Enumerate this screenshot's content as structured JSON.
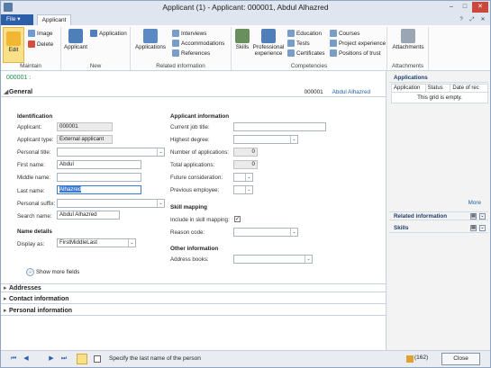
{
  "window": {
    "title": "Applicant (1) - Applicant: 000001, Abdul Alhazred",
    "min": "–",
    "max": "□",
    "close": "✕"
  },
  "tabs": {
    "file": "File",
    "file_arrow": "▾",
    "applicant": "Applicant"
  },
  "quick_icons": [
    "?",
    "⤢",
    "✕"
  ],
  "ribbon": {
    "maintain": {
      "label": "Maintain",
      "edit": "Edit",
      "image": "Image",
      "delete": "Delete"
    },
    "new": {
      "label": "New",
      "applicant": "Applicant",
      "application": "Application"
    },
    "related": {
      "label": "Related information",
      "applications": "Applications",
      "interviews": "Interviews",
      "accommodations": "Accommodations",
      "references": "References"
    },
    "competencies": {
      "label": "Competencies",
      "skills": "Skills",
      "professional": "Professional",
      "experience": "experience",
      "education": "Education",
      "tests": "Tests",
      "certificates": "Certificates",
      "courses": "Courses",
      "project_experience": "Project experience",
      "positions": "Positions of trust"
    },
    "attachments": {
      "label": "Attachments",
      "attachments": "Attachments"
    }
  },
  "crumb": "000001 :",
  "general": {
    "caret": "◢",
    "title": "General",
    "id": "000001",
    "name": "Abdul Alhazred"
  },
  "identification": {
    "heading": "Identification",
    "applicant_label": "Applicant:",
    "applicant_value": "000001",
    "type_label": "Applicant type:",
    "type_value": "External applicant",
    "personal_title_label": "Personal title:",
    "personal_title_value": "",
    "first_label": "First name:",
    "first_value": "Abdul",
    "middle_label": "Middle name:",
    "middle_value": "",
    "last_label": "Last name:",
    "last_value": "Alhazred",
    "suffix_label": "Personal suffix:",
    "suffix_value": "",
    "search_label": "Search name:",
    "search_value": "Abdul Alhazred"
  },
  "name_details": {
    "heading": "Name details",
    "display_label": "Display as:",
    "display_value": "FirstMiddleLast"
  },
  "show_more": {
    "icon": "⌄",
    "label": "Show more fields"
  },
  "applicant_info": {
    "heading": "Applicant information",
    "job_label": "Current job title:",
    "job_value": "",
    "degree_label": "Highest degree:",
    "degree_value": "",
    "numapps_label": "Number of applications:",
    "numapps_value": "0",
    "totalapps_label": "Total applications:",
    "totalapps_value": "0",
    "future_label": "Future consideration:",
    "future_value": "",
    "prev_label": "Previous employee:",
    "prev_value": ""
  },
  "skill_mapping": {
    "heading": "Skill mapping",
    "include_label": "Include in skill mapping:",
    "include_checked": "✓",
    "reason_label": "Reason code:",
    "reason_value": ""
  },
  "other_info": {
    "heading": "Other information",
    "address_books_label": "Address books:",
    "address_books_value": ""
  },
  "sections": [
    {
      "caret": "▸",
      "title": "Addresses"
    },
    {
      "caret": "▸",
      "title": "Contact information"
    },
    {
      "caret": "▸",
      "title": "Personal information"
    }
  ],
  "dropdown_arrow": "⌄",
  "right_pane": {
    "applications_title": "Applications",
    "columns": [
      "Application",
      "Status",
      "Date of rec"
    ],
    "empty": "This grid is empty.",
    "more": "More",
    "related_title": "Related information",
    "skills_title": "Skills",
    "ctl": [
      "▤",
      "⌄"
    ]
  },
  "statusbar": {
    "nav": [
      "⏮",
      "◀",
      "▶",
      "⏭"
    ],
    "message": "Specify the last name of the person",
    "badge": "(162)",
    "close": "Close"
  }
}
